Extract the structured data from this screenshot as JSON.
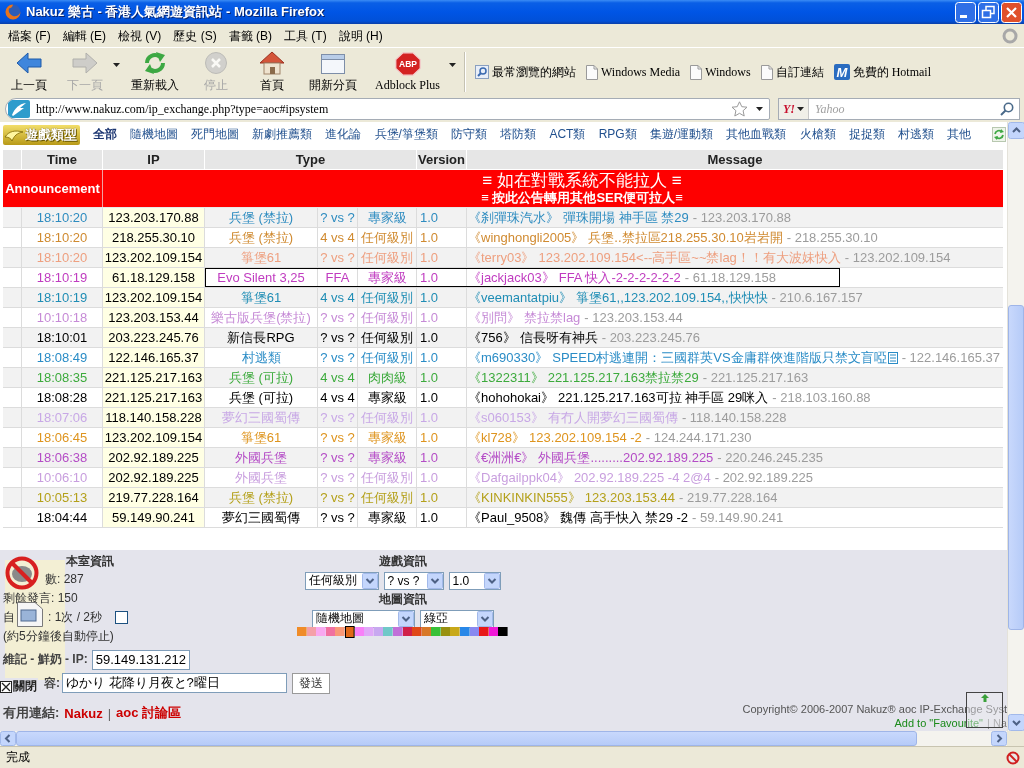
{
  "window": {
    "title": "Nakuz 樂古 - 香港人氣網遊資訊站 - Mozilla Firefox"
  },
  "menu": [
    "檔案 (F)",
    "編輯 (E)",
    "檢視 (V)",
    "歷史 (S)",
    "書籤 (B)",
    "工具 (T)",
    "說明 (H)"
  ],
  "toolbar": [
    {
      "label": "上一頁",
      "kind": "back",
      "disabled": false,
      "dropdown": false
    },
    {
      "label": "下一頁",
      "kind": "forward",
      "disabled": true,
      "dropdown": true
    },
    {
      "label": "重新載入",
      "kind": "reload",
      "disabled": false,
      "dropdown": false
    },
    {
      "label": "停止",
      "kind": "stop",
      "disabled": true,
      "dropdown": false
    },
    {
      "label": "首頁",
      "kind": "home",
      "disabled": false,
      "dropdown": false
    },
    {
      "label": "開新分頁",
      "kind": "newtab",
      "disabled": false,
      "dropdown": false
    },
    {
      "label": "Adblock Plus",
      "kind": "adblock",
      "icon_text": "ABP",
      "disabled": false,
      "dropdown": true
    }
  ],
  "bookmarks": [
    {
      "label": "最常瀏覽的網站",
      "kind": "smart"
    },
    {
      "label": "Windows Media",
      "kind": "page"
    },
    {
      "label": "Windows",
      "kind": "page"
    },
    {
      "label": "自訂連結",
      "kind": "page"
    },
    {
      "label": "免費的 Hotmail",
      "kind": "tile",
      "icon_text": "M"
    }
  ],
  "address_bar": {
    "value": "http://www.nakuz.com/ip_exchange.php?type=aoc#ipsystem"
  },
  "search": {
    "engine_icon_text": "Y!",
    "placeholder": "Yahoo"
  },
  "category_nav": {
    "logo": "遊戲類型",
    "items": [
      {
        "label": "全部",
        "selected": true
      },
      {
        "label": "隨機地圖",
        "selected": false
      },
      {
        "label": "死門地圖",
        "selected": false
      },
      {
        "label": "新劇推薦類",
        "selected": false
      },
      {
        "label": "進化論",
        "selected": false
      },
      {
        "label": "兵堡/箏堡類",
        "selected": false
      },
      {
        "label": "防守類",
        "selected": false
      },
      {
        "label": "塔防類",
        "selected": false
      },
      {
        "label": "ACT類",
        "selected": false
      },
      {
        "label": "RPG類",
        "selected": false
      },
      {
        "label": "集遊/運動類",
        "selected": false
      },
      {
        "label": "其他血戰類",
        "selected": false
      },
      {
        "label": "火槍類",
        "selected": false
      },
      {
        "label": "捉捉類",
        "selected": false
      },
      {
        "label": "村逃類",
        "selected": false
      },
      {
        "label": "其他",
        "selected": false
      }
    ]
  },
  "table": {
    "columns": [
      "Time",
      "IP",
      "Type",
      "Version",
      "Message"
    ],
    "announcement": {
      "label": "Announcement",
      "lines": [
        "≡ 如在對戰系統不能拉人 ≡",
        "≡ 按此公告轉用其他SER便可拉人≡"
      ]
    },
    "rows": [
      {
        "time": "18:10:20",
        "ip": "123.203.170.88",
        "type": "兵堡 (禁拉)",
        "players": "? vs ?",
        "level": "專家級",
        "version": "1.0",
        "sender": "《刹彈珠汽水》",
        "message": "彈珠開場 神手區 禁29",
        "source": "- 123.203.170.88",
        "color": "#2e8cc0",
        "highlighted": false,
        "emoticon": false
      },
      {
        "time": "18:10:20",
        "ip": "218.255.30.10",
        "type": "兵堡 (禁拉)",
        "players": "4 vs 4",
        "level": "任何級別",
        "version": "1.0",
        "sender": "《winghongli2005》",
        "message": "兵堡..禁拉區218.255.30.10岩岩開",
        "source": "- 218.255.30.10",
        "color": "#d08a30",
        "highlighted": false,
        "emoticon": false
      },
      {
        "time": "18:10:20",
        "ip": "123.202.109.154",
        "type": "箏堡61",
        "players": "? vs ?",
        "level": "任何級別",
        "version": "1.0",
        "sender": "《terry03》",
        "message": "123.202.109.154<--高手區~~禁lag！！有大波妹快入",
        "source": "- 123.202.109.154",
        "color": "#eea080",
        "highlighted": false,
        "emoticon": false
      },
      {
        "time": "18:10:19",
        "ip": "61.18.129.158",
        "type": "Evo Silent 3,25",
        "players": "FFA",
        "level": "專家級",
        "version": "1.0",
        "sender": "《jackjack03》",
        "message": "FFA 快入-2-2-2-2-2-2",
        "source": "- 61.18.129.158",
        "color": "#c03cc0",
        "highlighted": true,
        "emoticon": false
      },
      {
        "time": "18:10:19",
        "ip": "123.202.109.154",
        "type": "箏堡61",
        "players": "4 vs 4",
        "level": "任何級別",
        "version": "1.0",
        "sender": "《veemantatpiu》",
        "message": "箏堡61,,123.202.109.154,,快快快",
        "source": "- 210.6.167.157",
        "color": "#1f8db5",
        "highlighted": false,
        "emoticon": false
      },
      {
        "time": "10:10:18",
        "ip": "123.203.153.44",
        "type": "樂古版兵堡(禁拉)",
        "players": "? vs ?",
        "level": "任何級別",
        "version": "1.0",
        "sender": "《別問》",
        "message": "禁拉禁lag",
        "source": "- 123.203.153.44",
        "color": "#c68ad6",
        "highlighted": false,
        "emoticon": false
      },
      {
        "time": "18:10:01",
        "ip": "203.223.245.76",
        "type": "新信長RPG",
        "players": "? vs ?",
        "level": "任何級別",
        "version": "1.0",
        "sender": "《756》",
        "message": "信長呀有神兵",
        "source": "- 203.223.245.76",
        "color": "#000000",
        "highlighted": false,
        "emoticon": false
      },
      {
        "time": "18:08:49",
        "ip": "122.146.165.37",
        "type": "村逃類",
        "players": "? vs ?",
        "level": "任何級別",
        "version": "1.0",
        "sender": "《m690330》",
        "message": "SPEED村逃連開：三國群英VS金庸群俠進階版只禁文盲啞",
        "source": "- 122.146.165.37",
        "color": "#2a8cc6",
        "highlighted": false,
        "emoticon": true
      },
      {
        "time": "18:08:35",
        "ip": "221.125.217.163",
        "type": "兵堡 (可拉)",
        "players": "4 vs 4",
        "level": "肉肉級",
        "version": "1.0",
        "sender": "《1322311》",
        "message": "221.125.217.163禁拉禁29",
        "source": "- 221.125.217.163",
        "color": "#3caa3c",
        "highlighted": false,
        "emoticon": false
      },
      {
        "time": "18:08:28",
        "ip": "221.125.217.163",
        "type": "兵堡 (可拉)",
        "players": "4 vs 4",
        "level": "專家級",
        "version": "1.0",
        "sender": "《hohohokai》",
        "message": "221.125.217.163可拉 神手區 29咪入",
        "source": "- 218.103.160.88",
        "color": "#000000",
        "highlighted": false,
        "emoticon": false
      },
      {
        "time": "18:07:06",
        "ip": "118.140.158.228",
        "type": "夢幻三國蜀傳",
        "players": "? vs ?",
        "level": "任何級別",
        "version": "1.0",
        "sender": "《s060153》",
        "message": "有冇人開夢幻三國蜀傳",
        "source": "- 118.140.158.228",
        "color": "#c8a8e6",
        "highlighted": false,
        "emoticon": false
      },
      {
        "time": "18:06:45",
        "ip": "123.202.109.154",
        "type": "箏堡61",
        "players": "? vs ?",
        "level": "專家級",
        "version": "1.0",
        "sender": "《kl728》",
        "message": "123.202.109.154 -2",
        "source": "- 124.244.171.230",
        "color": "#de941e",
        "highlighted": false,
        "emoticon": false
      },
      {
        "time": "18:06:38",
        "ip": "202.92.189.225",
        "type": "外國兵堡",
        "players": "? vs ?",
        "level": "專家級",
        "version": "1.0",
        "sender": "《€洲洲€》",
        "message": "外國兵堡.........202.92.189.225",
        "source": "- 220.246.245.235",
        "color": "#b44cc6",
        "highlighted": false,
        "emoticon": false
      },
      {
        "time": "10:06:10",
        "ip": "202.92.189.225",
        "type": "外國兵堡",
        "players": "? vs ?",
        "level": "任何級別",
        "version": "1.0",
        "sender": "《Dafgailppk04》",
        "message": "202.92.189.225 -4 2@4",
        "source": "- 202.92.189.225",
        "color": "#c89ede",
        "highlighted": false,
        "emoticon": false
      },
      {
        "time": "10:05:13",
        "ip": "219.77.228.164",
        "type": "兵堡 (禁拉)",
        "players": "? vs ?",
        "level": "任何級別",
        "version": "1.0",
        "sender": "《KINKINKIN555》",
        "message": "123.203.153.44",
        "source": "- 219.77.228.164",
        "color": "#b4a01a",
        "highlighted": false,
        "emoticon": false
      },
      {
        "time": "18:04:44",
        "ip": "59.149.90.241",
        "type": "夢幻三國蜀傳",
        "players": "? vs ?",
        "level": "專家級",
        "version": "1.0",
        "sender": "《Paul_9508》",
        "message": "魏傳 高手快入 禁29 -2",
        "source": "- 59.149.90.241",
        "color": "#000000",
        "highlighted": false,
        "emoticon": false
      }
    ]
  },
  "room_info": {
    "title": "本室資訊",
    "visitors": "數: 287",
    "remaining": "剩餘發言: 150",
    "auto_refresh": [
      "自",
      ": 1次 / 2秒"
    ],
    "auto_checked": false,
    "auto_note": "(約5分鐘後自動停止)",
    "nickname_label": "維記 - 鮮奶 - IP:",
    "ip_value": "59.149.131.212",
    "message_label": "容:",
    "message_value": "ゆかり 花降り月夜と?曜日",
    "send_button": "發送",
    "links_label": "有用連結:",
    "links": [
      "Nakuz",
      "aoc 討論區"
    ],
    "links_separator": "|"
  },
  "game_info": {
    "title": "遊戲資訊",
    "selects": [
      "任何級別",
      "? vs ?",
      "1.0"
    ],
    "map_title": "地圖資訊",
    "map_selects": [
      "隨機地圖",
      "綠亞"
    ],
    "palette": [
      {
        "color": "#f08c28",
        "selected": false
      },
      {
        "color": "#f4a0a8",
        "selected": false
      },
      {
        "color": "#f8a8f0",
        "selected": false
      },
      {
        "color": "#f070a0",
        "selected": false
      },
      {
        "color": "#f89878",
        "selected": false
      },
      {
        "color": "#e06818",
        "selected": true
      },
      {
        "color": "#f880f8",
        "selected": false
      },
      {
        "color": "#e0a8f8",
        "selected": false
      },
      {
        "color": "#c8a8f0",
        "selected": false
      },
      {
        "color": "#70c8c8",
        "selected": false
      },
      {
        "color": "#c070d8",
        "selected": false
      },
      {
        "color": "#d02048",
        "selected": false
      },
      {
        "color": "#e04818",
        "selected": false
      },
      {
        "color": "#d87828",
        "selected": false
      },
      {
        "color": "#38c038",
        "selected": false
      },
      {
        "color": "#989010",
        "selected": false
      },
      {
        "color": "#c8a818",
        "selected": false
      },
      {
        "color": "#2888e8",
        "selected": false
      },
      {
        "color": "#8888f0",
        "selected": false
      },
      {
        "color": "#e81818",
        "selected": false
      },
      {
        "color": "#f018d8",
        "selected": false
      },
      {
        "color": "#000000",
        "selected": false
      }
    ]
  },
  "floating_widget": {
    "close_label": "關閉"
  },
  "footer": {
    "copyright": "Copyright© 2006-2007  Nakuz® aoc IP-Exchange Syst",
    "favourite_link": "Add to \"Favourite\"",
    "more": "| Na"
  },
  "status_bar": {
    "text": "完成"
  }
}
